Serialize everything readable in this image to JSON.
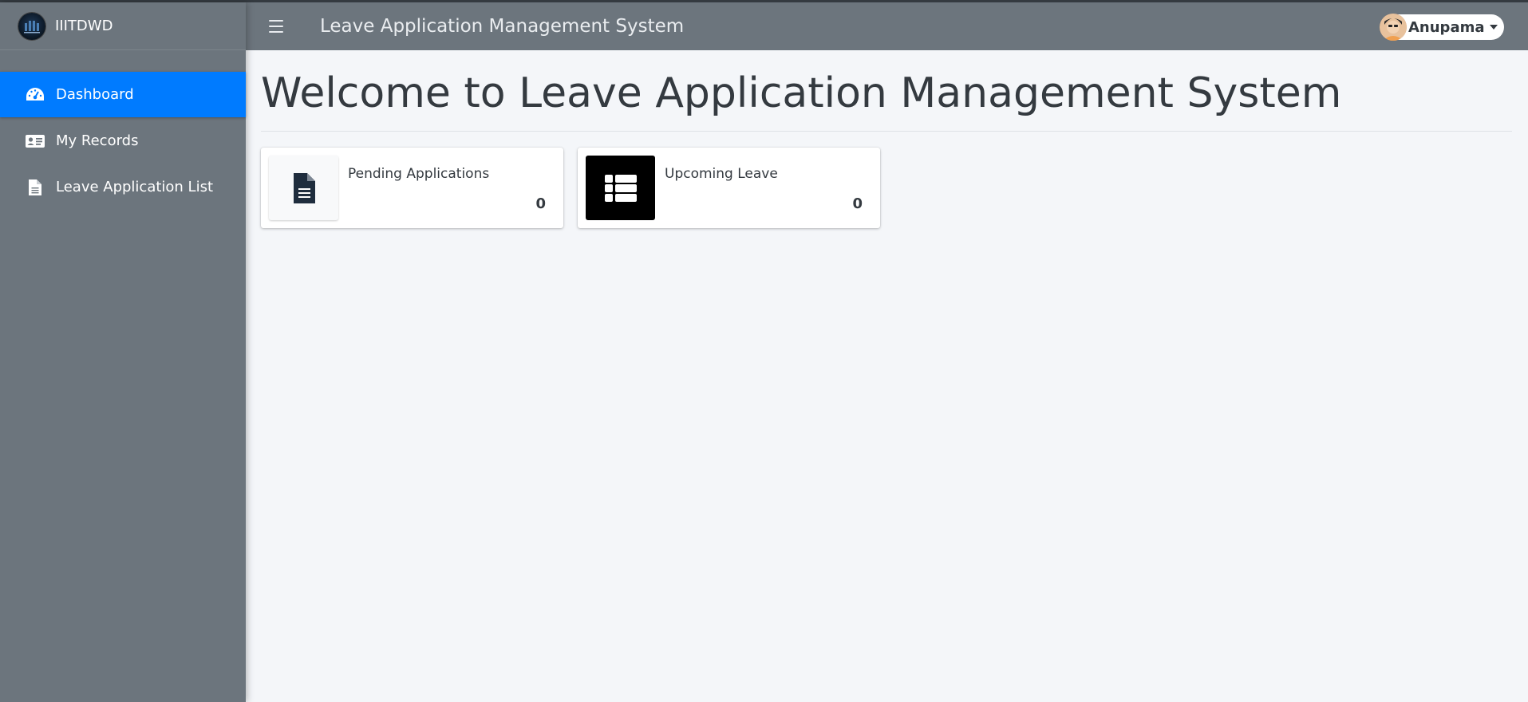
{
  "brand": {
    "name": "IIITDWD",
    "logo_icon": "college-logo-icon"
  },
  "header": {
    "title": "Leave Application Management System",
    "menu_icon": "hamburger-icon"
  },
  "user": {
    "name": "Anupama",
    "avatar_icon": "user-avatar-icon",
    "caret_icon": "caret-down-icon"
  },
  "sidebar": {
    "items": [
      {
        "label": "Dashboard",
        "icon": "tachometer-icon",
        "active": true
      },
      {
        "label": "My Records",
        "icon": "id-card-icon",
        "active": false
      },
      {
        "label": "Leave Application List",
        "icon": "file-icon",
        "active": false
      }
    ]
  },
  "main": {
    "title": "Welcome to Leave Application Management System",
    "cards": [
      {
        "label": "Pending Applications",
        "count": "0",
        "icon": "file-alt-icon"
      },
      {
        "label": "Upcoming Leave",
        "count": "0",
        "icon": "th-list-icon"
      }
    ]
  },
  "colors": {
    "sidebar_bg": "#6c757d",
    "active_nav": "#007bff",
    "content_bg": "#f4f6f9",
    "text_dark": "#343a40"
  }
}
